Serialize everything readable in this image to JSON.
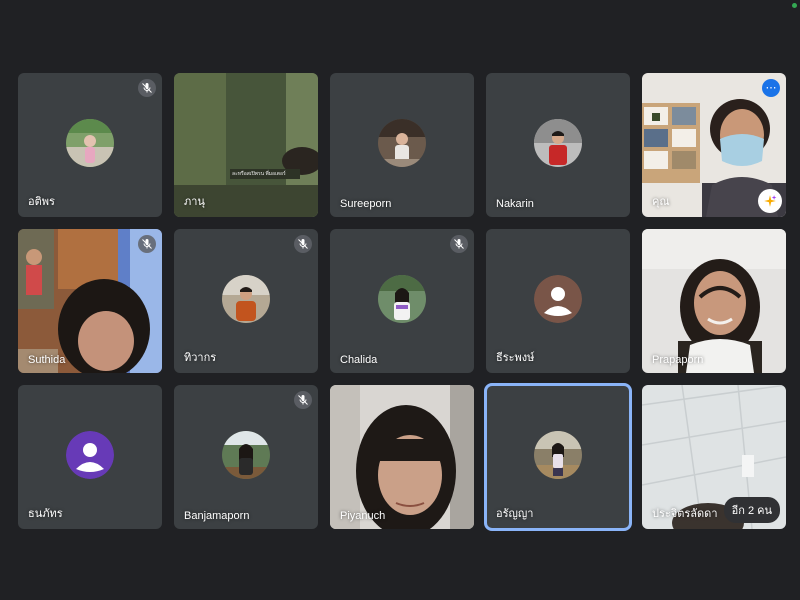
{
  "participants": [
    {
      "name": "อติพร",
      "muted": true,
      "type": "avatar",
      "avatar_bg": "#8d9c7a"
    },
    {
      "name": "ภานุ",
      "muted": false,
      "type": "video",
      "overlay_text": "ละหรือสเปิพรน พี่มอเตอร์"
    },
    {
      "name": "Sureeporn",
      "muted": false,
      "type": "avatar",
      "avatar_bg": "#6b5a4c"
    },
    {
      "name": "Nakarin",
      "muted": false,
      "type": "avatar",
      "avatar_bg": "#7a7a78"
    },
    {
      "name": "คุณ",
      "muted": false,
      "type": "video",
      "is_self": true
    },
    {
      "name": "Suthida",
      "muted": true,
      "type": "video"
    },
    {
      "name": "ทิวากร",
      "muted": true,
      "type": "avatar",
      "avatar_bg": "#8f7a66"
    },
    {
      "name": "Chalida",
      "muted": true,
      "type": "avatar",
      "avatar_bg": "#6f8d6a"
    },
    {
      "name": "ธีระพงษ์",
      "muted": false,
      "type": "default-avatar",
      "avatar_bg": "#795548"
    },
    {
      "name": "Prapaporn",
      "muted": false,
      "type": "video"
    },
    {
      "name": "ธนภัทร",
      "muted": false,
      "type": "default-avatar",
      "avatar_bg": "#673ab7"
    },
    {
      "name": "Banjamaporn",
      "muted": true,
      "type": "avatar",
      "avatar_bg": "#5f7a55"
    },
    {
      "name": "Piyanuch",
      "muted": false,
      "type": "video"
    },
    {
      "name": "อรัญญา",
      "muted": false,
      "type": "avatar",
      "avatar_bg": "#8a7f68",
      "active_speaker": true
    },
    {
      "name": "ประจิตรลัดดา",
      "muted": false,
      "type": "video",
      "others_badge": "อีก 2 คน"
    }
  ],
  "colors": {
    "background": "#202124",
    "tile": "#3c4043",
    "active_outline": "#8ab4f8",
    "status_dot": "#34a853"
  },
  "icons": {
    "mute": "mic-off-icon",
    "more": "more-options-icon",
    "effects": "sparkle-effects-icon"
  }
}
